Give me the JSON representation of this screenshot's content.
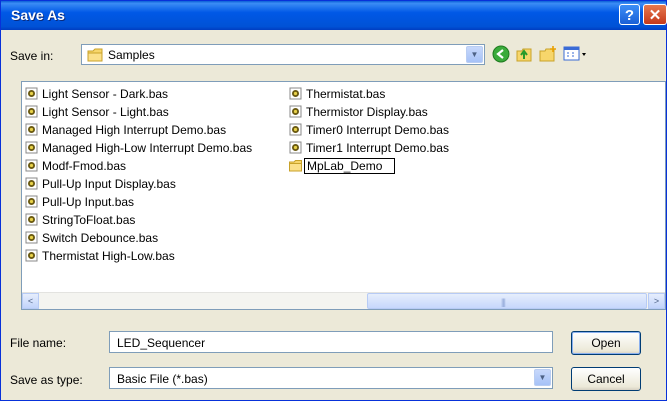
{
  "window": {
    "title": "Save As"
  },
  "controls": {
    "help_glyph": "?",
    "close_glyph": "✕"
  },
  "save_in": {
    "label": "Save in:",
    "value": "Samples"
  },
  "toolbar": {
    "icons": [
      "back-icon",
      "up-folder-icon",
      "new-folder-icon",
      "views-menu-icon"
    ]
  },
  "files": {
    "column1": [
      "Light Sensor - Dark.bas",
      "Light Sensor - Light.bas",
      "Managed High Interrupt Demo.bas",
      "Managed High-Low Interrupt Demo.bas",
      "Modf-Fmod.bas",
      "Pull-Up Input Display.bas",
      "Pull-Up Input.bas",
      "StringToFloat.bas",
      "Switch Debounce.bas",
      "Thermistat High-Low.bas"
    ],
    "column2": [
      "Thermistat.bas",
      "Thermistor Display.bas",
      "Timer0 Interrupt Demo.bas",
      "Timer1 Interrupt Demo.bas"
    ],
    "folder": "MpLab_Demo"
  },
  "scrollbar": {
    "left_arrow": "<",
    "right_arrow": ">",
    "grip": "|||"
  },
  "file_name": {
    "label": "File name:",
    "value": "LED_Sequencer"
  },
  "save_type": {
    "label": "Save as type:",
    "value": "Basic File (*.bas)"
  },
  "buttons": {
    "open": "Open",
    "cancel": "Cancel"
  },
  "colors": {
    "titlebar": "#0058e6",
    "dialog_bg": "#ece9d8",
    "field_border": "#7f9db9"
  }
}
